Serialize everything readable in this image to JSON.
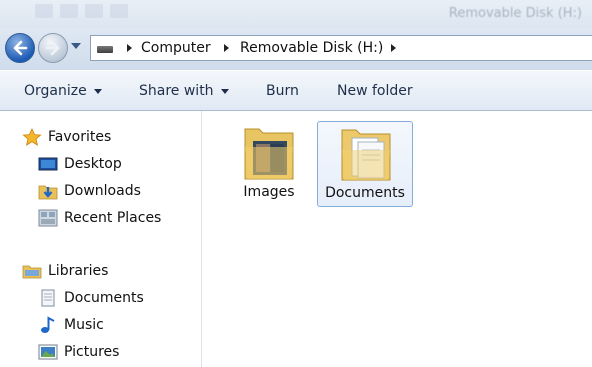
{
  "window": {
    "title": "Removable Disk (H:)"
  },
  "address_bar": {
    "crumbs": [
      "Computer",
      "Removable Disk (H:)"
    ]
  },
  "command_bar": {
    "organize": "Organize",
    "share_with": "Share with",
    "burn": "Burn",
    "new_folder": "New folder"
  },
  "nav_pane": {
    "favorites": {
      "label": "Favorites",
      "items": [
        {
          "label": "Desktop",
          "icon": "desktop-icon"
        },
        {
          "label": "Downloads",
          "icon": "downloads-icon"
        },
        {
          "label": "Recent Places",
          "icon": "recent-places-icon"
        }
      ]
    },
    "libraries": {
      "label": "Libraries",
      "items": [
        {
          "label": "Documents",
          "icon": "documents-icon"
        },
        {
          "label": "Music",
          "icon": "music-icon"
        },
        {
          "label": "Pictures",
          "icon": "pictures-icon"
        }
      ]
    }
  },
  "files": [
    {
      "name": "Images",
      "type": "folder",
      "selected": false
    },
    {
      "name": "Documents",
      "type": "folder",
      "selected": true
    }
  ],
  "colors": {
    "accent": "#1d5bb4",
    "folder": "#f2cf6e",
    "selection_border": "#84acdd"
  }
}
